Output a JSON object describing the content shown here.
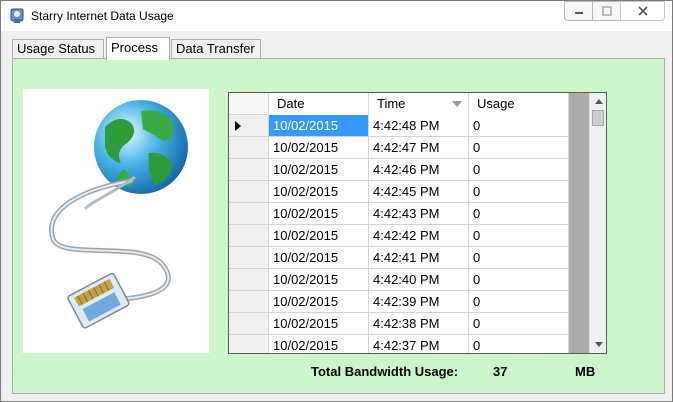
{
  "window": {
    "title": "Starry Internet Data Usage",
    "icon": "app-icon"
  },
  "tabs": [
    {
      "label": "Usage Status",
      "active": false
    },
    {
      "label": "Process",
      "active": true
    },
    {
      "label": "Data Transfer",
      "active": false
    }
  ],
  "colors": {
    "panel_bg": "#ccf5cc",
    "selection": "#3399ff",
    "grid_bg": "#ababab"
  },
  "grid": {
    "columns": [
      "Date",
      "Time",
      "Usage"
    ],
    "sorted_column": "Time",
    "rows": [
      {
        "date": "10/02/2015",
        "time": "4:42:48 PM",
        "usage": "0"
      },
      {
        "date": "10/02/2015",
        "time": "4:42:47 PM",
        "usage": "0"
      },
      {
        "date": "10/02/2015",
        "time": "4:42:46 PM",
        "usage": "0"
      },
      {
        "date": "10/02/2015",
        "time": "4:42:45 PM",
        "usage": "0"
      },
      {
        "date": "10/02/2015",
        "time": "4:42:43 PM",
        "usage": "0"
      },
      {
        "date": "10/02/2015",
        "time": "4:42:42 PM",
        "usage": "0"
      },
      {
        "date": "10/02/2015",
        "time": "4:42:41 PM",
        "usage": "0"
      },
      {
        "date": "10/02/2015",
        "time": "4:42:40 PM",
        "usage": "0"
      },
      {
        "date": "10/02/2015",
        "time": "4:42:39 PM",
        "usage": "0"
      },
      {
        "date": "10/02/2015",
        "time": "4:42:38 PM",
        "usage": "0"
      },
      {
        "date": "10/02/2015",
        "time": "4:42:37 PM",
        "usage": "0"
      }
    ]
  },
  "total": {
    "label": "Total Bandwidth Usage:",
    "value": "37",
    "unit": "MB"
  }
}
